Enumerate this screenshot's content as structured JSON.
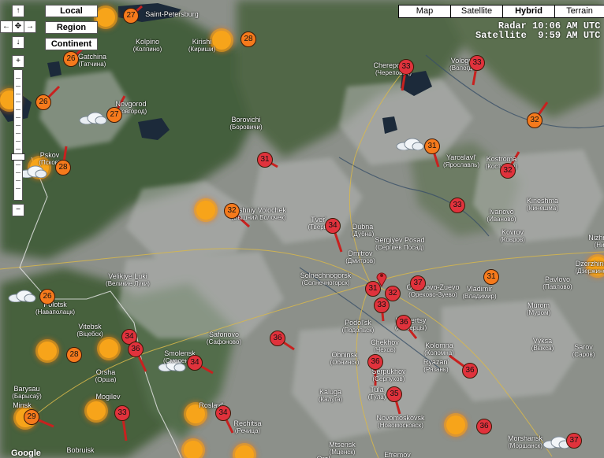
{
  "controls": {
    "local": "Local",
    "region": "Region",
    "continent": "Continent",
    "pan_up": "↑",
    "pan_left": "←",
    "pan_center": "✥",
    "pan_right": "→",
    "pan_down": "↓",
    "zoom_in": "+",
    "zoom_out": "−"
  },
  "map_types": [
    "Map",
    "Satellite",
    "Hybrid",
    "Terrain"
  ],
  "map_type_active": "Hybrid",
  "status": {
    "radar": "Radar 10:06 AM UTC",
    "satellite": "Satellite  9:59 AM UTC"
  },
  "footer": {
    "logo": "Google"
  },
  "cities": [
    {
      "name": "Saint-Petersburg",
      "ru": ""
    },
    {
      "name": "Kolpino",
      "ru": "(Колпино)"
    },
    {
      "name": "Kirishi",
      "ru": "(Кириши)"
    },
    {
      "name": "Gatchina",
      "ru": "(Гатчина)"
    },
    {
      "name": "Cherepovets",
      "ru": "(Череповец)"
    },
    {
      "name": "Vologda",
      "ru": "(Вологда)"
    },
    {
      "name": "Novgorod",
      "ru": "(Новгород)"
    },
    {
      "name": "Borovichi",
      "ru": "(Боровичи)"
    },
    {
      "name": "Pskov",
      "ru": "(Псков)"
    },
    {
      "name": "Yaroslavl'",
      "ru": "(Ярославль)"
    },
    {
      "name": "Kostroma",
      "ru": "(Кострома)"
    },
    {
      "name": "Vyshniy Volochek",
      "ru": "(Вышний Волочек)"
    },
    {
      "name": "Kineshma",
      "ru": "(Кинешма)"
    },
    {
      "name": "Ivanovo",
      "ru": "(Иваново)"
    },
    {
      "name": "Tver'",
      "ru": "(Тверь)"
    },
    {
      "name": "Dubna",
      "ru": "(Дубна)"
    },
    {
      "name": "Sergiyev Posad",
      "ru": "(Сергиев Посад)"
    },
    {
      "name": "Dmitrov",
      "ru": "(Дмитров)"
    },
    {
      "name": "Kovrov",
      "ru": "(Ковров)"
    },
    {
      "name": "Velikiye Luki",
      "ru": "(Великие Луки)"
    },
    {
      "name": "Solnechnogorsk",
      "ru": "(Солнечногорск)"
    },
    {
      "name": "Orekhovo-Zuevo",
      "ru": "(Орехово-Зуево)"
    },
    {
      "name": "Dzerzhinsk",
      "ru": "(Дзержинск)"
    },
    {
      "name": "Pavlovo",
      "ru": "(Павлово)"
    },
    {
      "name": "Vladimir",
      "ru": "(Владимир)"
    },
    {
      "name": "Polotsk",
      "ru": "(Наваполацк)"
    },
    {
      "name": "Murom",
      "ru": "(Муром)"
    },
    {
      "name": "Podol'sk",
      "ru": "(Подольск)"
    },
    {
      "name": "Lyubertsy",
      "ru": "(Люберцы)"
    },
    {
      "name": "Vitebsk",
      "ru": "(Вiцебск)"
    },
    {
      "name": "Safonovo",
      "ru": "(Сафоново)"
    },
    {
      "name": "Vyksa",
      "ru": "(Выкса)"
    },
    {
      "name": "Chekhov",
      "ru": "(Чехов)"
    },
    {
      "name": "Kolomna",
      "ru": "(Коломна)"
    },
    {
      "name": "Sarov",
      "ru": "(Саров)"
    },
    {
      "name": "Smolensk",
      "ru": "(Смоленск)"
    },
    {
      "name": "Obninsk",
      "ru": "(Обнинск)"
    },
    {
      "name": "Serpukhov",
      "ru": "(Серпухов)"
    },
    {
      "name": "Orsha",
      "ru": "(Орша)"
    },
    {
      "name": "Ryazan'",
      "ru": "(Рязань)"
    },
    {
      "name": "Barysau",
      "ru": "(Барысаў)"
    },
    {
      "name": "Kaluga",
      "ru": "(Калуга)"
    },
    {
      "name": "Tula",
      "ru": "(Тула)"
    },
    {
      "name": "Minsk",
      "ru": ""
    },
    {
      "name": "Mogilev",
      "ru": ""
    },
    {
      "name": "Roslavl'",
      "ru": ""
    },
    {
      "name": "Novomoskovsk",
      "ru": "(Новомосковск)"
    },
    {
      "name": "Rechitsa",
      "ru": "(Речица)"
    },
    {
      "name": "Bobruisk",
      "ru": ""
    },
    {
      "name": "Mtsensk",
      "ru": "(Мценск)"
    },
    {
      "name": "Efremov",
      "ru": "(Ефремов)"
    },
    {
      "name": "Orel",
      "ru": ""
    },
    {
      "name": "Morshansk",
      "ru": "(Моршанск)"
    },
    {
      "name": "Nizhny",
      "ru": "(Ни"
    }
  ],
  "stations": [
    {
      "temp": "27",
      "color": "orange"
    },
    {
      "temp": "28",
      "color": "orange"
    },
    {
      "temp": "26",
      "color": "orange"
    },
    {
      "temp": "26",
      "color": "orange"
    },
    {
      "temp": "27",
      "color": "orange"
    },
    {
      "temp": "28",
      "color": "orange"
    },
    {
      "temp": "33",
      "color": "red"
    },
    {
      "temp": "33",
      "color": "red"
    },
    {
      "temp": "32",
      "color": "orange"
    },
    {
      "temp": "31",
      "color": "orange"
    },
    {
      "temp": "32",
      "color": "red"
    },
    {
      "temp": "31",
      "color": "red"
    },
    {
      "temp": "32",
      "color": "orange"
    },
    {
      "temp": "33",
      "color": "red"
    },
    {
      "temp": "34",
      "color": "red"
    },
    {
      "temp": "31",
      "color": "orange"
    },
    {
      "temp": "26",
      "color": "orange"
    },
    {
      "temp": "31",
      "color": "red"
    },
    {
      "temp": "32",
      "color": "red"
    },
    {
      "temp": "37",
      "color": "red"
    },
    {
      "temp": "33",
      "color": "red"
    },
    {
      "temp": "36",
      "color": "red"
    },
    {
      "temp": "36",
      "color": "red"
    },
    {
      "temp": "34",
      "color": "red"
    },
    {
      "temp": "36",
      "color": "red"
    },
    {
      "temp": "28",
      "color": "orange"
    },
    {
      "temp": "34",
      "color": "red"
    },
    {
      "temp": "36",
      "color": "red"
    },
    {
      "temp": "36",
      "color": "red"
    },
    {
      "temp": "35",
      "color": "red"
    },
    {
      "temp": "29",
      "color": "orange"
    },
    {
      "temp": "33",
      "color": "red"
    },
    {
      "temp": "34",
      "color": "red"
    },
    {
      "temp": "36",
      "color": "red"
    },
    {
      "temp": "37",
      "color": "red"
    }
  ]
}
